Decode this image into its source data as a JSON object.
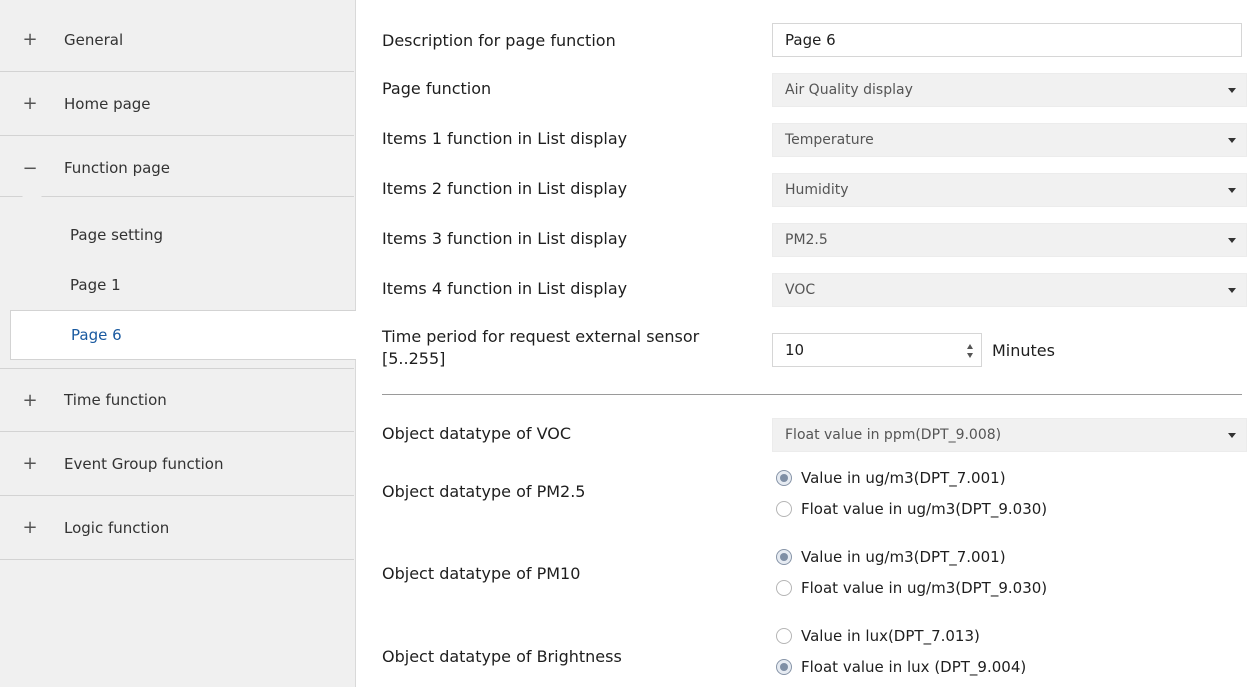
{
  "sidebar": {
    "items": [
      {
        "sign": "+",
        "label": "General"
      },
      {
        "sign": "+",
        "label": "Home page"
      },
      {
        "sign": "−",
        "label": "Function page"
      },
      {
        "sign": "+",
        "label": "Time function"
      },
      {
        "sign": "+",
        "label": "Event Group function"
      },
      {
        "sign": "+",
        "label": "Logic function"
      }
    ],
    "subitems": [
      {
        "label": "Page setting"
      },
      {
        "label": "Page 1"
      },
      {
        "label": "Page 6",
        "active": true
      }
    ]
  },
  "form": {
    "description": {
      "label": "Description for page function",
      "value": "Page 6"
    },
    "page_function": {
      "label": "Page function",
      "value": "Air Quality display"
    },
    "item1": {
      "label": "Items 1 function in List display",
      "value": "Temperature"
    },
    "item2": {
      "label": "Items 2 function in List display",
      "value": "Humidity"
    },
    "item3": {
      "label": "Items 3 function in List display",
      "value": "PM2.5"
    },
    "item4": {
      "label": "Items 4 function in List display",
      "value": "VOC"
    },
    "time_period": {
      "label_line1": "Time period for request external sensor",
      "label_line2": "[5..255]",
      "value": "10",
      "unit": "Minutes"
    },
    "voc_type": {
      "label": "Object datatype of VOC",
      "value": "Float value in ppm(DPT_9.008)"
    },
    "pm25_type": {
      "label": "Object datatype of PM2.5",
      "options": [
        "Value in ug/m3(DPT_7.001)",
        "Float value in ug/m3(DPT_9.030)"
      ],
      "selected": 0
    },
    "pm10_type": {
      "label": "Object datatype of PM10",
      "options": [
        "Value in ug/m3(DPT_7.001)",
        "Float value in ug/m3(DPT_9.030)"
      ],
      "selected": 0
    },
    "brightness_type": {
      "label": "Object datatype of Brightness",
      "options": [
        "Value in lux(DPT_7.013)",
        "Float value in lux (DPT_9.004)"
      ],
      "selected": 1
    }
  },
  "icons": {
    "expand": "plus-icon",
    "collapse": "minus-icon",
    "dropdown": "chevron-down-icon",
    "spinner": "spinner-arrows-icon"
  },
  "colors": {
    "active_nav_text": "#1a5aa0",
    "sidebar_bg": "#f0f0f0",
    "radio_selected": "#7f8fa5"
  }
}
